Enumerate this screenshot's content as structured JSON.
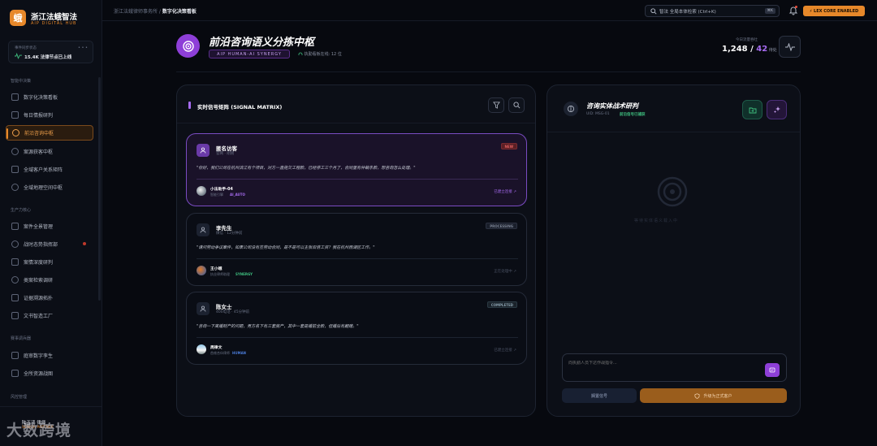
{
  "brand": {
    "logo": "蛾",
    "title": "浙江法蛾智法",
    "subtitle": "AIP DIGITAL HUB"
  },
  "sync": {
    "label": "事件同步状态",
    "value": "15.4K 法律节点已上线",
    "dots": "• • •"
  },
  "sections": {
    "decision": "智能中决策",
    "production": "生产力核心",
    "battle": "赛事调兵器",
    "risk": "风控管理"
  },
  "nav_decision": [
    {
      "label": "数字化决策看板",
      "active": false
    },
    {
      "label": "每日情报研判",
      "active": false
    },
    {
      "label": "前沿咨询中枢",
      "active": true
    },
    {
      "label": "案源获客中枢",
      "active": false
    },
    {
      "label": "全域客户关系矩阵",
      "active": false
    },
    {
      "label": "全域地理空间中枢",
      "active": false
    }
  ],
  "nav_production": [
    {
      "label": "案件全景管理"
    },
    {
      "label": "战时态势指挥部"
    },
    {
      "label": "案情深度研判"
    },
    {
      "label": "类案检索调研"
    },
    {
      "label": "证据溯源拓扑"
    },
    {
      "label": "文书智造工厂"
    }
  ],
  "nav_battle": [
    {
      "label": "庭审数字孪生"
    },
    {
      "label": "全所资源战图"
    }
  ],
  "bottom": {
    "watermark": "大数跨境",
    "name": "陆玉鸿 律师",
    "role": "SENIOR PARTNER"
  },
  "topbar": {
    "crumb_parent": "浙江法蛾律师事务所 /",
    "crumb_current": "数字化决策看板",
    "search_placeholder": "智法 全局本体检索 (Ctrl+K)",
    "search_kbd": "⌘K",
    "core_badge": "⚡ LEX CORE ENABLED"
  },
  "header": {
    "title": "前沿咨询语义分拣中枢",
    "badge": "AIP HUMAN-AI SYNERGY",
    "online": "执勤看板在线: 12 位",
    "stat_label": "今日流量吞吐",
    "stat_main": "1,248",
    "stat_sep": " / ",
    "stat_accent": "42",
    "stat_unit": " 待处"
  },
  "signal_matrix": {
    "title": "实时信号矩阵 (SIGNAL MATRIX)",
    "cards": [
      {
        "name": "匿名访客",
        "meta": "官网 · 刚刚",
        "status": "NEW",
        "quote": "\"你好，我们公司在杭州滨江有个项目，对方一直拖欠工程款，已经停工三个月了，合同里有仲裁条款，想咨询怎么处理。\"",
        "agent_name": "小法助手-04",
        "agent_role": "智能引擎",
        "agent_tag": "AI_AUTO",
        "link": "已建立连接 ↗"
      },
      {
        "name": "李先生",
        "meta": "微信 · 12分钟前",
        "status": "PROCESSING",
        "quote": "\"请问劳动争议案件，如果公司没有签劳动合同，是不是可以主张双倍工资？我在杭州西湖区工作。\"",
        "agent_name": "王小蛾",
        "agent_role": "执业律师助理",
        "agent_tag": "SYNERGY",
        "link": "正在处理中 ↗"
      },
      {
        "name": "陈女士",
        "meta": "400电话 · 45分钟前",
        "status": "COMPLETED",
        "quote": "\"咨询一下离婚财产的问题，男方名下有三套房产，其中一套是婚前全款，但婚后有翻建。\"",
        "agent_name": "周律文",
        "agent_role": "首席合伙律师",
        "agent_tag": "HUMAN",
        "link": "已建立连接 ↗"
      }
    ]
  },
  "strategy": {
    "title": "咨询实体战术研判",
    "uid": "UID: MSG-01",
    "tag": "前沿信号已捕获",
    "empty_text": "等待实体语义载入中",
    "input_placeholder": "向执勤人员下达作战指令...",
    "mark_label": "搁置信号",
    "upgrade_label": "升级为正式客户"
  },
  "colors": {
    "accent": "#e7882a",
    "purple": "#8e3fd8",
    "green": "#3fbf7f"
  }
}
